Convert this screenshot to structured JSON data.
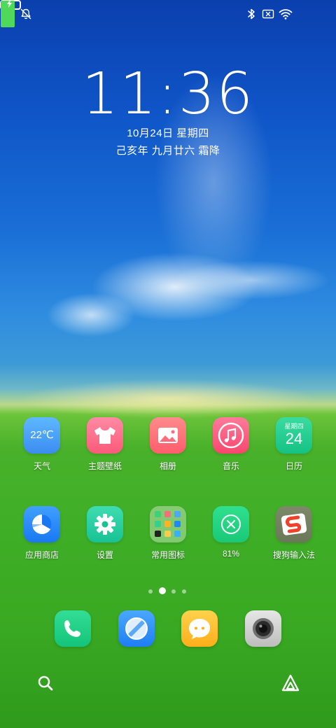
{
  "status_bar": {
    "icons": [
      "bell-muted-icon",
      "bluetooth-icon",
      "sim-disabled-icon",
      "wifi-icon",
      "battery-charging-icon"
    ],
    "battery_level_fraction": 0.85
  },
  "lockscreen": {
    "time": "11:36",
    "date": "10月24日 星期四",
    "lunar": "己亥年 九月廿六 霜降"
  },
  "apps_row1": [
    {
      "label": "天气",
      "icon": "weather-icon",
      "value": "22℃"
    },
    {
      "label": "主题壁纸",
      "icon": "tshirt-icon"
    },
    {
      "label": "相册",
      "icon": "gallery-icon"
    },
    {
      "label": "音乐",
      "icon": "music-note-icon"
    },
    {
      "label": "日历",
      "icon": "calendar-icon",
      "weekday": "星期四",
      "day": "24"
    }
  ],
  "apps_row2": [
    {
      "label": "应用商店",
      "icon": "app-store-icon"
    },
    {
      "label": "设置",
      "icon": "gear-icon"
    },
    {
      "label": "常用图标",
      "icon": "folder-icon"
    },
    {
      "label": "81%",
      "icon": "cleaner-icon"
    },
    {
      "label": "搜狗输入法",
      "icon": "sogou-s-icon"
    }
  ],
  "page_indicator": {
    "pages": 4,
    "current": 2
  },
  "dock": [
    {
      "icon": "phone-icon"
    },
    {
      "icon": "browser-compass-icon"
    },
    {
      "icon": "message-bubble-icon"
    },
    {
      "icon": "camera-lens-icon"
    }
  ],
  "bottom_bar": {
    "left": "search-icon",
    "right": "assistant-icon"
  },
  "colors": {
    "sky_top": "#0b3fae",
    "grass": "#3fae27",
    "battery_fill": "#4fd95a"
  }
}
